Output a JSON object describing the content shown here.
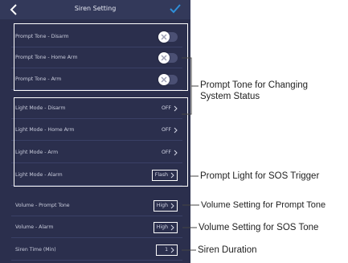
{
  "nav": {
    "title": "Siren Setting"
  },
  "prompt_section": {
    "rows": [
      {
        "label": "Prompt Tone - Disarm"
      },
      {
        "label": "Prompt Tone - Home Arm"
      },
      {
        "label": "Prompt Tone - Arm"
      }
    ]
  },
  "light_section": {
    "rows": [
      {
        "label": "Light Mode - Disarm",
        "value": "OFF"
      },
      {
        "label": "Light Mode - Home Arm",
        "value": "OFF"
      },
      {
        "label": "Light Mode - Arm",
        "value": "OFF"
      },
      {
        "label": "Light Mode - Alarm",
        "value": "Flash"
      }
    ]
  },
  "volume_section": {
    "rows": [
      {
        "label": "Volume - Prompt Tone",
        "value": "High"
      },
      {
        "label": "Volume - Alarm",
        "value": "High"
      },
      {
        "label": "Siren Time (Min)",
        "value": "1"
      }
    ]
  },
  "annotations": {
    "prompt_tone_line1": "Prompt Tone for Changing",
    "prompt_tone_line2": "System Status",
    "prompt_light": "Prompt Light for SOS Trigger",
    "volume_prompt": "Volume Setting for Prompt Tone",
    "volume_sos": "Volume Setting for SOS Tone",
    "siren_duration": "Siren Duration"
  },
  "colors": {
    "background": "#2b2f4d",
    "navbar": "#33395a",
    "accent": "#2f8fd8"
  }
}
